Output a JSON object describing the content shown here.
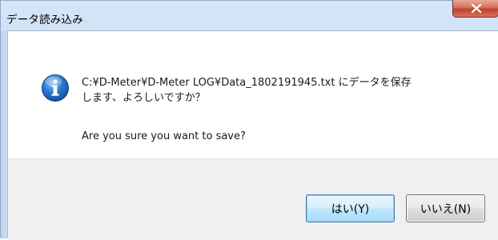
{
  "window": {
    "title": "データ読み込み"
  },
  "dialog": {
    "message_line1": "C:¥D-Meter¥D-Meter LOG¥Data_1802191945.txt にデータを保存",
    "message_line2": "します、よろしいですか？",
    "message_english": "Are you sure you want to save?",
    "icon": "info-icon"
  },
  "buttons": {
    "yes_label": "はい(Y)",
    "no_label": "いいえ(N)"
  },
  "colors": {
    "title_bar": "#c4d9f0",
    "close_button": "#c0412b",
    "info_icon": "#1b5fb4",
    "default_button_border": "#3c7fb1"
  }
}
